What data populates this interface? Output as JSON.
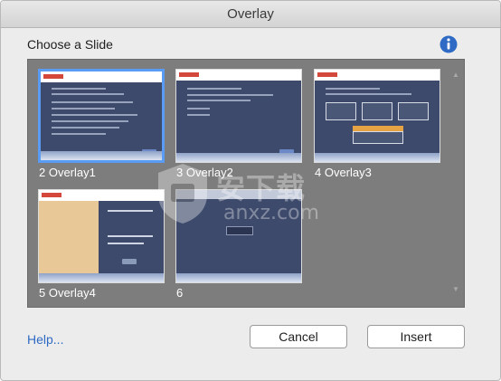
{
  "window": {
    "title": "Overlay"
  },
  "header": {
    "choose_label": "Choose a Slide",
    "info_icon": "info-icon"
  },
  "slides": [
    {
      "number": "2",
      "label": "2  Overlay1",
      "selected": true
    },
    {
      "number": "3",
      "label": "3  Overlay2",
      "selected": false
    },
    {
      "number": "4",
      "label": "4  Overlay3",
      "selected": false
    },
    {
      "number": "5",
      "label": "5  Overlay4",
      "selected": false
    },
    {
      "number": "6",
      "label": "6",
      "selected": false
    }
  ],
  "watermark": {
    "text": "安下载",
    "url": "anxz.com"
  },
  "footer": {
    "help_label": "Help...",
    "cancel_label": "Cancel",
    "insert_label": "Insert"
  },
  "colors": {
    "selection": "#5a9cf3",
    "slide_background": "#3d4a6b",
    "panel_background": "#7d7d7d",
    "link": "#2f6bc4"
  }
}
